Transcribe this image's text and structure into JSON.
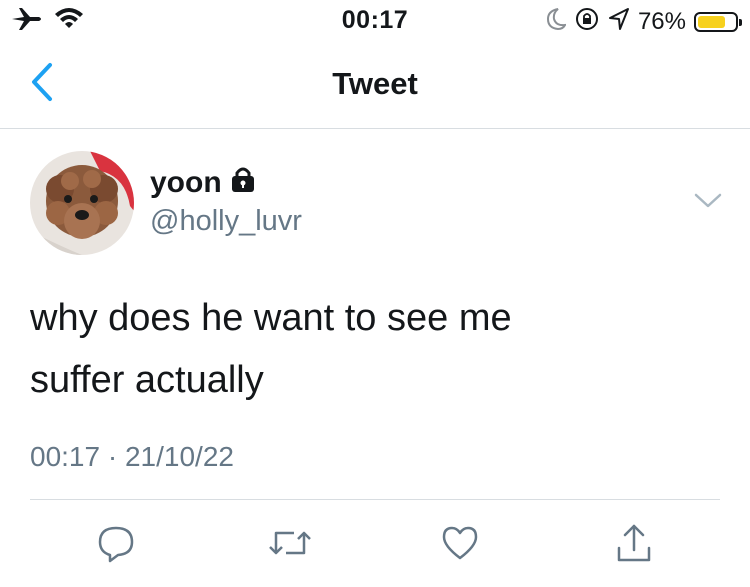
{
  "status_bar": {
    "time": "00:17",
    "battery_percent": "76%",
    "battery_level": 0.76,
    "left_icons": [
      "airplane-icon",
      "wifi-icon"
    ],
    "right_icons": [
      "moon-icon",
      "rotation-lock-icon",
      "location-arrow-icon",
      "battery-icon"
    ]
  },
  "nav": {
    "title": "Tweet",
    "back_icon": "chevron-left-icon"
  },
  "tweet": {
    "display_name": "yoon",
    "protected_icon": "lock-icon",
    "handle": "@holly_luvr",
    "text_line1": "why does he want to see me",
    "text_line2": "suffer actually",
    "time": "00:17",
    "separator": "·",
    "date": "21/10/22"
  },
  "actions": [
    {
      "name": "reply",
      "icon": "reply-icon"
    },
    {
      "name": "retweet",
      "icon": "retweet-icon"
    },
    {
      "name": "like",
      "icon": "heart-icon"
    },
    {
      "name": "share",
      "icon": "share-icon"
    }
  ],
  "colors": {
    "accent": "#1da1f2",
    "text": "#14171a",
    "secondary_text": "#657786",
    "divider": "#d8dde1",
    "battery": "#f7d11e"
  }
}
